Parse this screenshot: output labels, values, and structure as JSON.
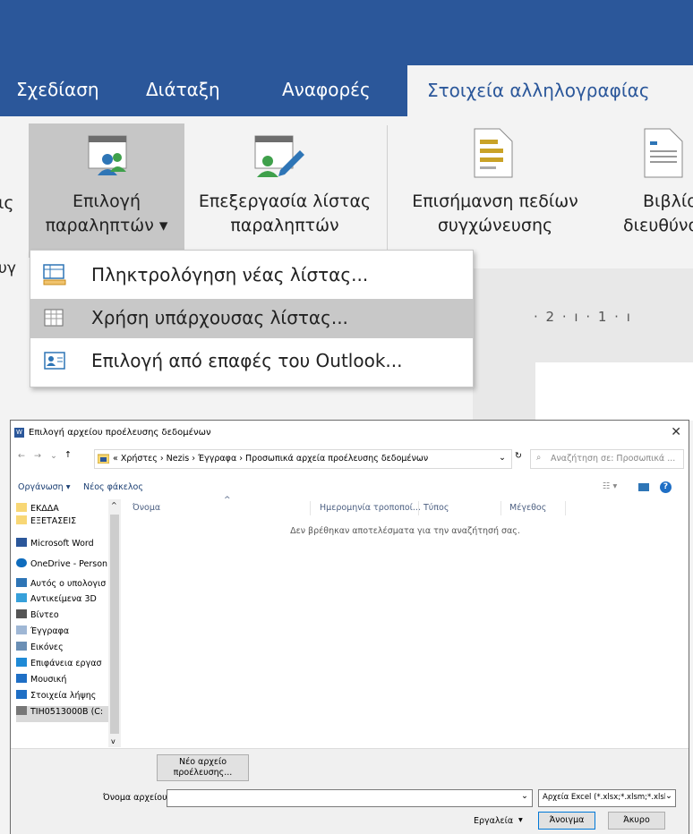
{
  "word": {
    "tabs": [
      "Σχεδίαση",
      "Διάταξη",
      "Αναφορές"
    ],
    "active_tab": "Στοιχεία αλληλογραφίας",
    "ribbon": {
      "left_cut_1": "ις",
      "left_cut_2": "υγ",
      "select_recipients_1": "Επιλογή",
      "select_recipients_2": "παραληπτών ▾",
      "edit_list_1": "Επεξεργασία λίστας",
      "edit_list_2": "παραληπτών",
      "highlight_1": "Επισήμανση πεδίων",
      "highlight_2": "συγχώνευσης",
      "address_1": "Βιβλίο",
      "address_2": "διευθύνσ"
    },
    "menu": [
      {
        "label": "Πληκτρολόγηση νέας λίστας...",
        "selected": false
      },
      {
        "label": "Χρήση υπάρχουσας λίστας...",
        "selected": true
      },
      {
        "label": "Επιλογή από επαφές του Outlook...",
        "selected": false
      }
    ],
    "ruler": "· 2 · ı · 1 · ı"
  },
  "dialog": {
    "title": "Επιλογή αρχείου προέλευσης δεδομένων",
    "close": "✕",
    "breadcrumb": "« Χρήστες  ›  Nezis  ›  Έγγραφα  ›  Προσωπικά αρχεία προέλευσης δεδομένων",
    "search_placeholder": "Αναζήτηση σε: Προσωπικά ...",
    "organize": "Οργάνωση ▾",
    "new_folder": "Νέος φάκελος",
    "nav_items": [
      {
        "label": "ΕΚΔΔΑ",
        "icon": "folder-icon"
      },
      {
        "label": "ΕΞΕΤΑΣΕΙΣ",
        "icon": "folder-icon"
      },
      {
        "label": "Microsoft Word",
        "icon": "word-icon"
      },
      {
        "label": "OneDrive - Person",
        "icon": "onedrive-icon"
      },
      {
        "label": "Αυτός ο υπολογισ",
        "icon": "computer-icon"
      },
      {
        "label": "Αντικείμενα 3D",
        "icon": "cube-icon"
      },
      {
        "label": "Βίντεο",
        "icon": "video-icon"
      },
      {
        "label": "Έγγραφα",
        "icon": "document-icon"
      },
      {
        "label": "Εικόνες",
        "icon": "image-icon"
      },
      {
        "label": "Επιφάνεια εργασ",
        "icon": "desktop-icon"
      },
      {
        "label": "Μουσική",
        "icon": "music-icon"
      },
      {
        "label": "Στοιχεία λήψης",
        "icon": "download-icon"
      },
      {
        "label": "TIH0513000B (C:",
        "icon": "drive-icon"
      }
    ],
    "columns": [
      "Όνομα",
      "Ημερομηνία τροποποί...",
      "Τύπος",
      "Μέγεθος"
    ],
    "empty_message": "Δεν βρέθηκαν αποτελέσματα για την αναζήτησή σας.",
    "new_source_1": "Νέο αρχείο",
    "new_source_2": "προέλευσης...",
    "filename_label": "Όνομα αρχείου:",
    "filename_value": "",
    "filetype": "Αρχεία Excel (*.xlsx;*.xlsm;*.xlsl",
    "tools": "Εργαλεία",
    "open": "Άνοιγμα",
    "cancel": "Άκυρο"
  },
  "colors": {
    "word_blue": "#2b579a",
    "selection_grey": "#c8c8c8",
    "folder_yellow": "#f8d775"
  }
}
